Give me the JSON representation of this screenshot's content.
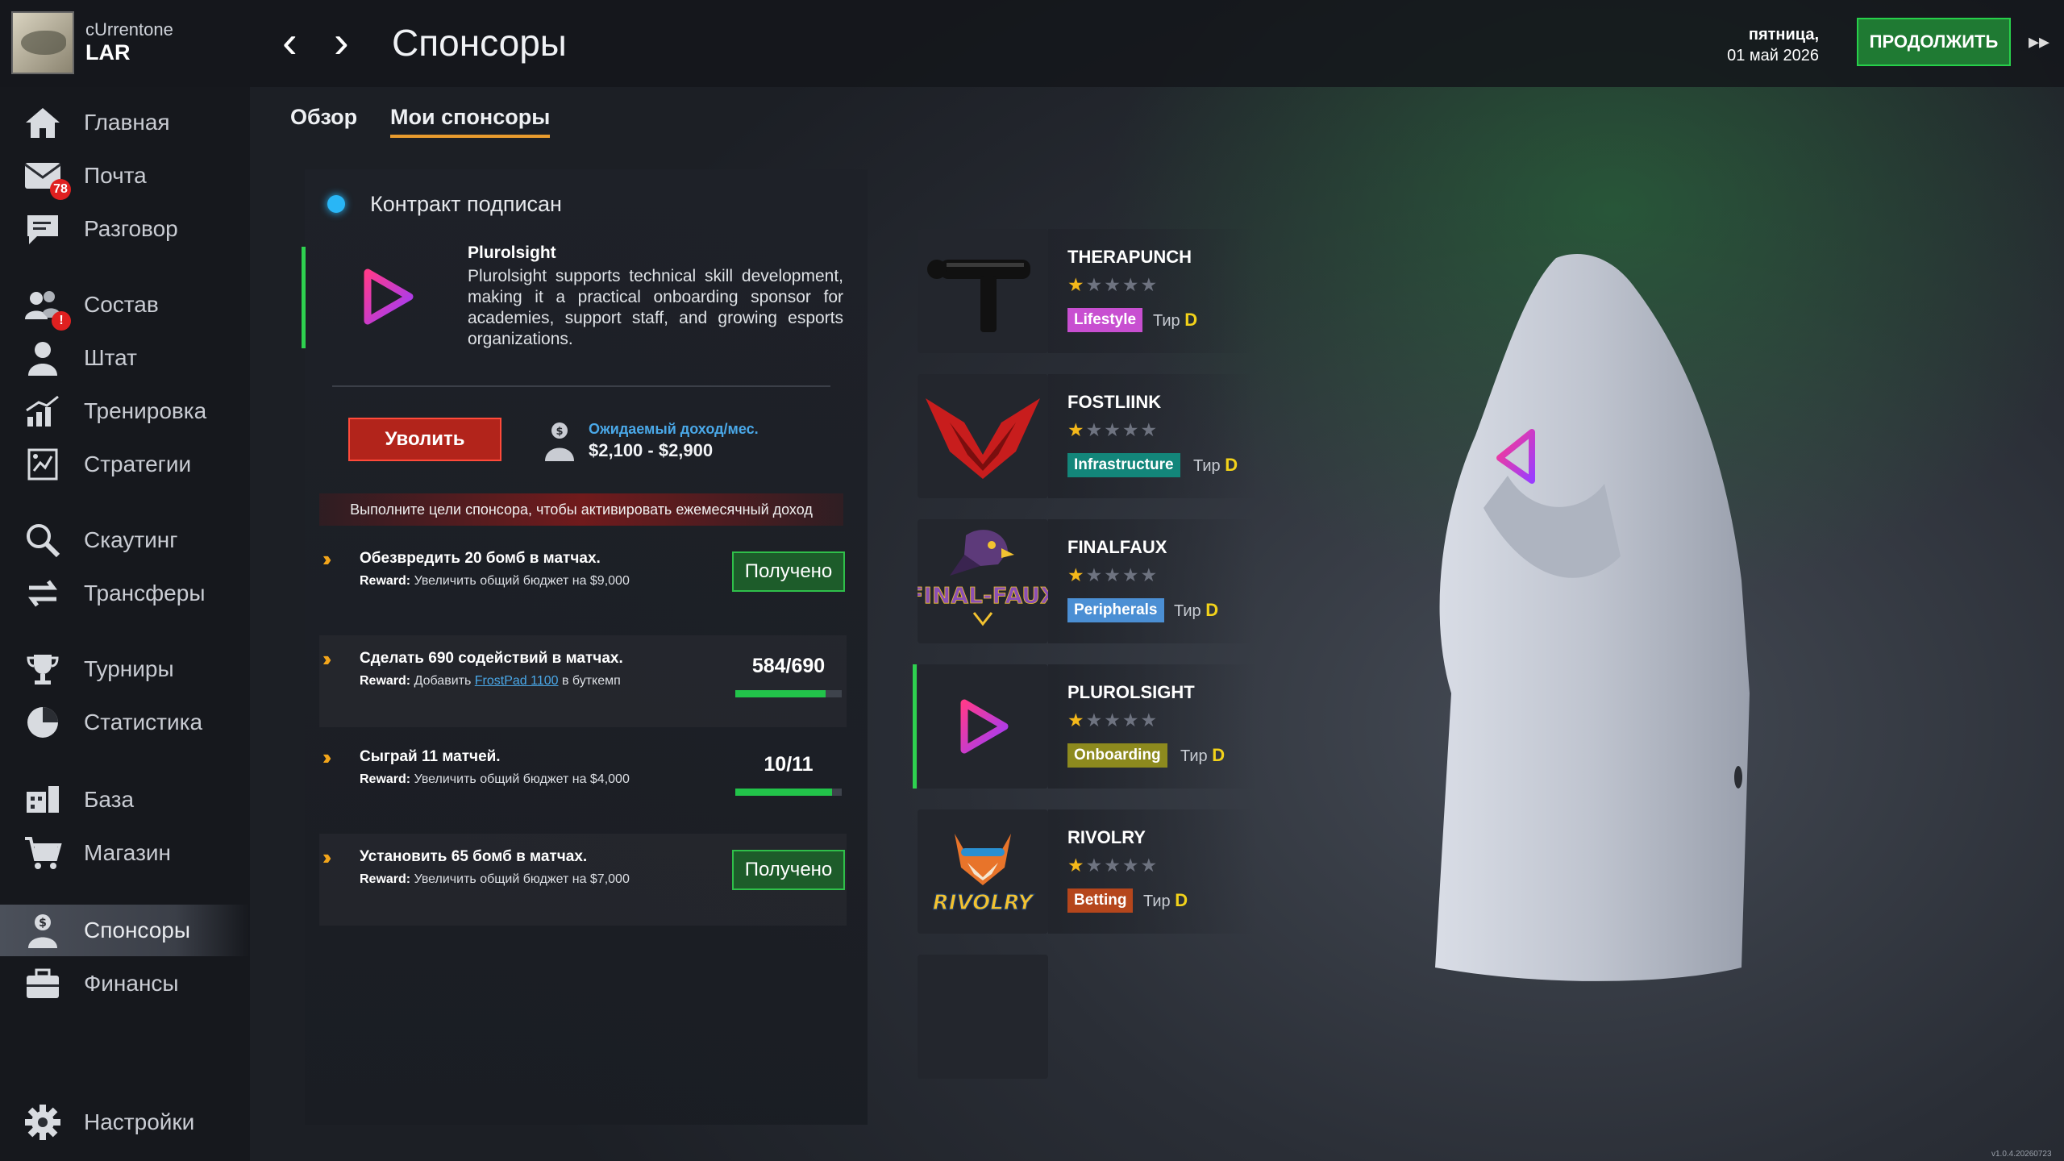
{
  "header": {
    "team_small": "cUrrentone",
    "team_name": "LAR",
    "back_icon": "chevron-left-icon",
    "forward_icon": "chevron-right-icon",
    "title": "Спонсоры",
    "date_day": "пятница,",
    "date_full": "01 май 2026",
    "continue_label": "ПРОДОЛЖИТЬ",
    "fast_forward_icon": "fast-forward-icon"
  },
  "sidebar": {
    "items": [
      {
        "label": "Главная",
        "icon": "home-icon"
      },
      {
        "label": "Почта",
        "icon": "mail-icon",
        "badge": "78"
      },
      {
        "label": "Разговор",
        "icon": "chat-icon"
      },
      {
        "label": "Состав",
        "icon": "roster-icon",
        "badge": "!"
      },
      {
        "label": "Штат",
        "icon": "staff-icon"
      },
      {
        "label": "Тренировка",
        "icon": "training-icon"
      },
      {
        "label": "Стратегии",
        "icon": "strategy-icon"
      },
      {
        "label": "Скаутинг",
        "icon": "scouting-icon"
      },
      {
        "label": "Трансферы",
        "icon": "transfers-icon"
      },
      {
        "label": "Турниры",
        "icon": "trophy-icon"
      },
      {
        "label": "Статистика",
        "icon": "pie-chart-icon"
      },
      {
        "label": "База",
        "icon": "base-icon"
      },
      {
        "label": "Магазин",
        "icon": "cart-icon"
      },
      {
        "label": "Спонсоры",
        "icon": "sponsor-icon"
      },
      {
        "label": "Финансы",
        "icon": "briefcase-icon"
      },
      {
        "label": "Настройки",
        "icon": "gear-icon"
      }
    ],
    "active": "Спонсоры"
  },
  "tabs": [
    {
      "label": "Обзор"
    },
    {
      "label": "Мои спонсоры"
    }
  ],
  "contract": {
    "status": "Контракт подписан",
    "status_color": "#29b6f6",
    "sponsor_name": "Plurolsight",
    "description": "Plurolsight supports technical skill development, making it a practical onboarding sponsor for academies, support staff, and growing esports organizations.",
    "fire_label": "Уволить",
    "income_label": "Ожидаемый доход/мес.",
    "income_value": "$2,100 - $2,900",
    "warning": "Выполните цели спонсора, чтобы активировать ежемесячный доход"
  },
  "goals": [
    {
      "title": "Обезвредить 20 бомб в матчах.",
      "reward_prefix": "Reward:",
      "reward": "Увеличить общий бюджет на $9,000",
      "state": "Получено"
    },
    {
      "title": "Сделать 690 содействий в матчах.",
      "reward_prefix": "Reward:",
      "reward_pre": "Добавить",
      "reward_link": "FrostPad 1100",
      "reward_post": "в буткемп",
      "progress": "584/690",
      "progress_value": 584,
      "progress_max": 690
    },
    {
      "title": "Сыграй 11 матчей.",
      "reward_prefix": "Reward:",
      "reward": "Увеличить общий бюджет на $4,000",
      "progress": "10/11",
      "progress_value": 10,
      "progress_max": 11
    },
    {
      "title": "Установить 65 бомб в матчах.",
      "reward_prefix": "Reward:",
      "reward": "Увеличить общий бюджет на $7,000",
      "state": "Получено"
    }
  ],
  "sponsors": [
    {
      "name": "THERAPUNCH",
      "stars": 1,
      "max_stars": 5,
      "category": "Lifestyle",
      "category_color": "#c84fd1",
      "tier_label": "Тир",
      "tier": "D",
      "logo": "massage-gun-logo"
    },
    {
      "name": "FOSTLIINK",
      "stars": 1,
      "max_stars": 5,
      "category": "Infrastructure",
      "category_color": "#13867a",
      "tier_label": "Тир",
      "tier": "D",
      "logo": "red-v-logo"
    },
    {
      "name": "FINALFAUX",
      "stars": 1,
      "max_stars": 5,
      "category": "Peripherals",
      "category_color": "#4b8fd4",
      "tier_label": "Тир",
      "tier": "D",
      "logo": "falcon-logo",
      "logo_text": "FINAL-FAUX"
    },
    {
      "name": "PLUROLSIGHT",
      "stars": 1,
      "max_stars": 5,
      "category": "Onboarding",
      "category_color": "#8d8a1e",
      "tier_label": "Тир",
      "tier": "D",
      "logo": "play-triangle-logo",
      "active": true
    },
    {
      "name": "RIVOLRY",
      "stars": 1,
      "max_stars": 5,
      "category": "Betting",
      "category_color": "#b5461c",
      "tier_label": "Тир",
      "tier": "D",
      "logo": "fox-logo",
      "logo_text": "RIVOLRY"
    }
  ],
  "colors": {
    "accent_green": "#2ed14f",
    "tab_underline": "#e89b2e",
    "star": "#f4b81a",
    "tier": "#f2d21a",
    "fire": "#b2241b"
  },
  "version": "v1.0.4.20260723"
}
